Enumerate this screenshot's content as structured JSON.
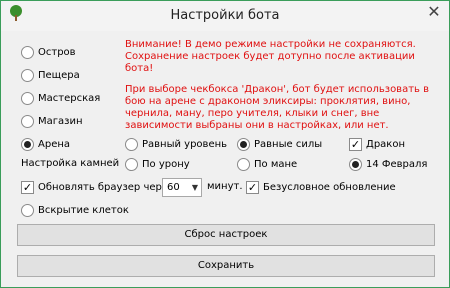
{
  "window": {
    "title": "Настройки бота",
    "close_glyph": "✕"
  },
  "locations": [
    {
      "label": "Остров",
      "checked": false
    },
    {
      "label": "Пещера",
      "checked": false
    },
    {
      "label": "Мастерская",
      "checked": false
    },
    {
      "label": "Магазин",
      "checked": false
    },
    {
      "label": "Арена",
      "checked": true
    }
  ],
  "warning": {
    "line1": "Внимание! В демо режиме настройки не сохраняются.",
    "line2": "Сохранение настроек будет дотупно после активации бота!"
  },
  "info": "При выборе чекбокса 'Дракон', бот будет использовать в бою на арене с драконом эликсиры: проклятия, вино, чернила, ману, перо учителя, клыки и снег, вне зависимости выбраны они в настройках, или нет.",
  "arena_options": {
    "equal_level": "Равный уровень",
    "equal_strength": "Равные силы",
    "dragon": "Дракон"
  },
  "stones": {
    "label": "Настройка камней",
    "by_damage": "По урону",
    "by_mana": "По мане",
    "feb14": "14 Февраля"
  },
  "refresh": {
    "label": "Обновлять браузер через",
    "value": "60",
    "unit": "минут.",
    "unconditional": "Безусловное обновление"
  },
  "cells": {
    "label": "Вскрытие клеток"
  },
  "buttons": {
    "reset": "Сброс настроек",
    "save": "Сохранить"
  },
  "colors": {
    "warning": "#e01010",
    "border": "#3a9d5a"
  }
}
